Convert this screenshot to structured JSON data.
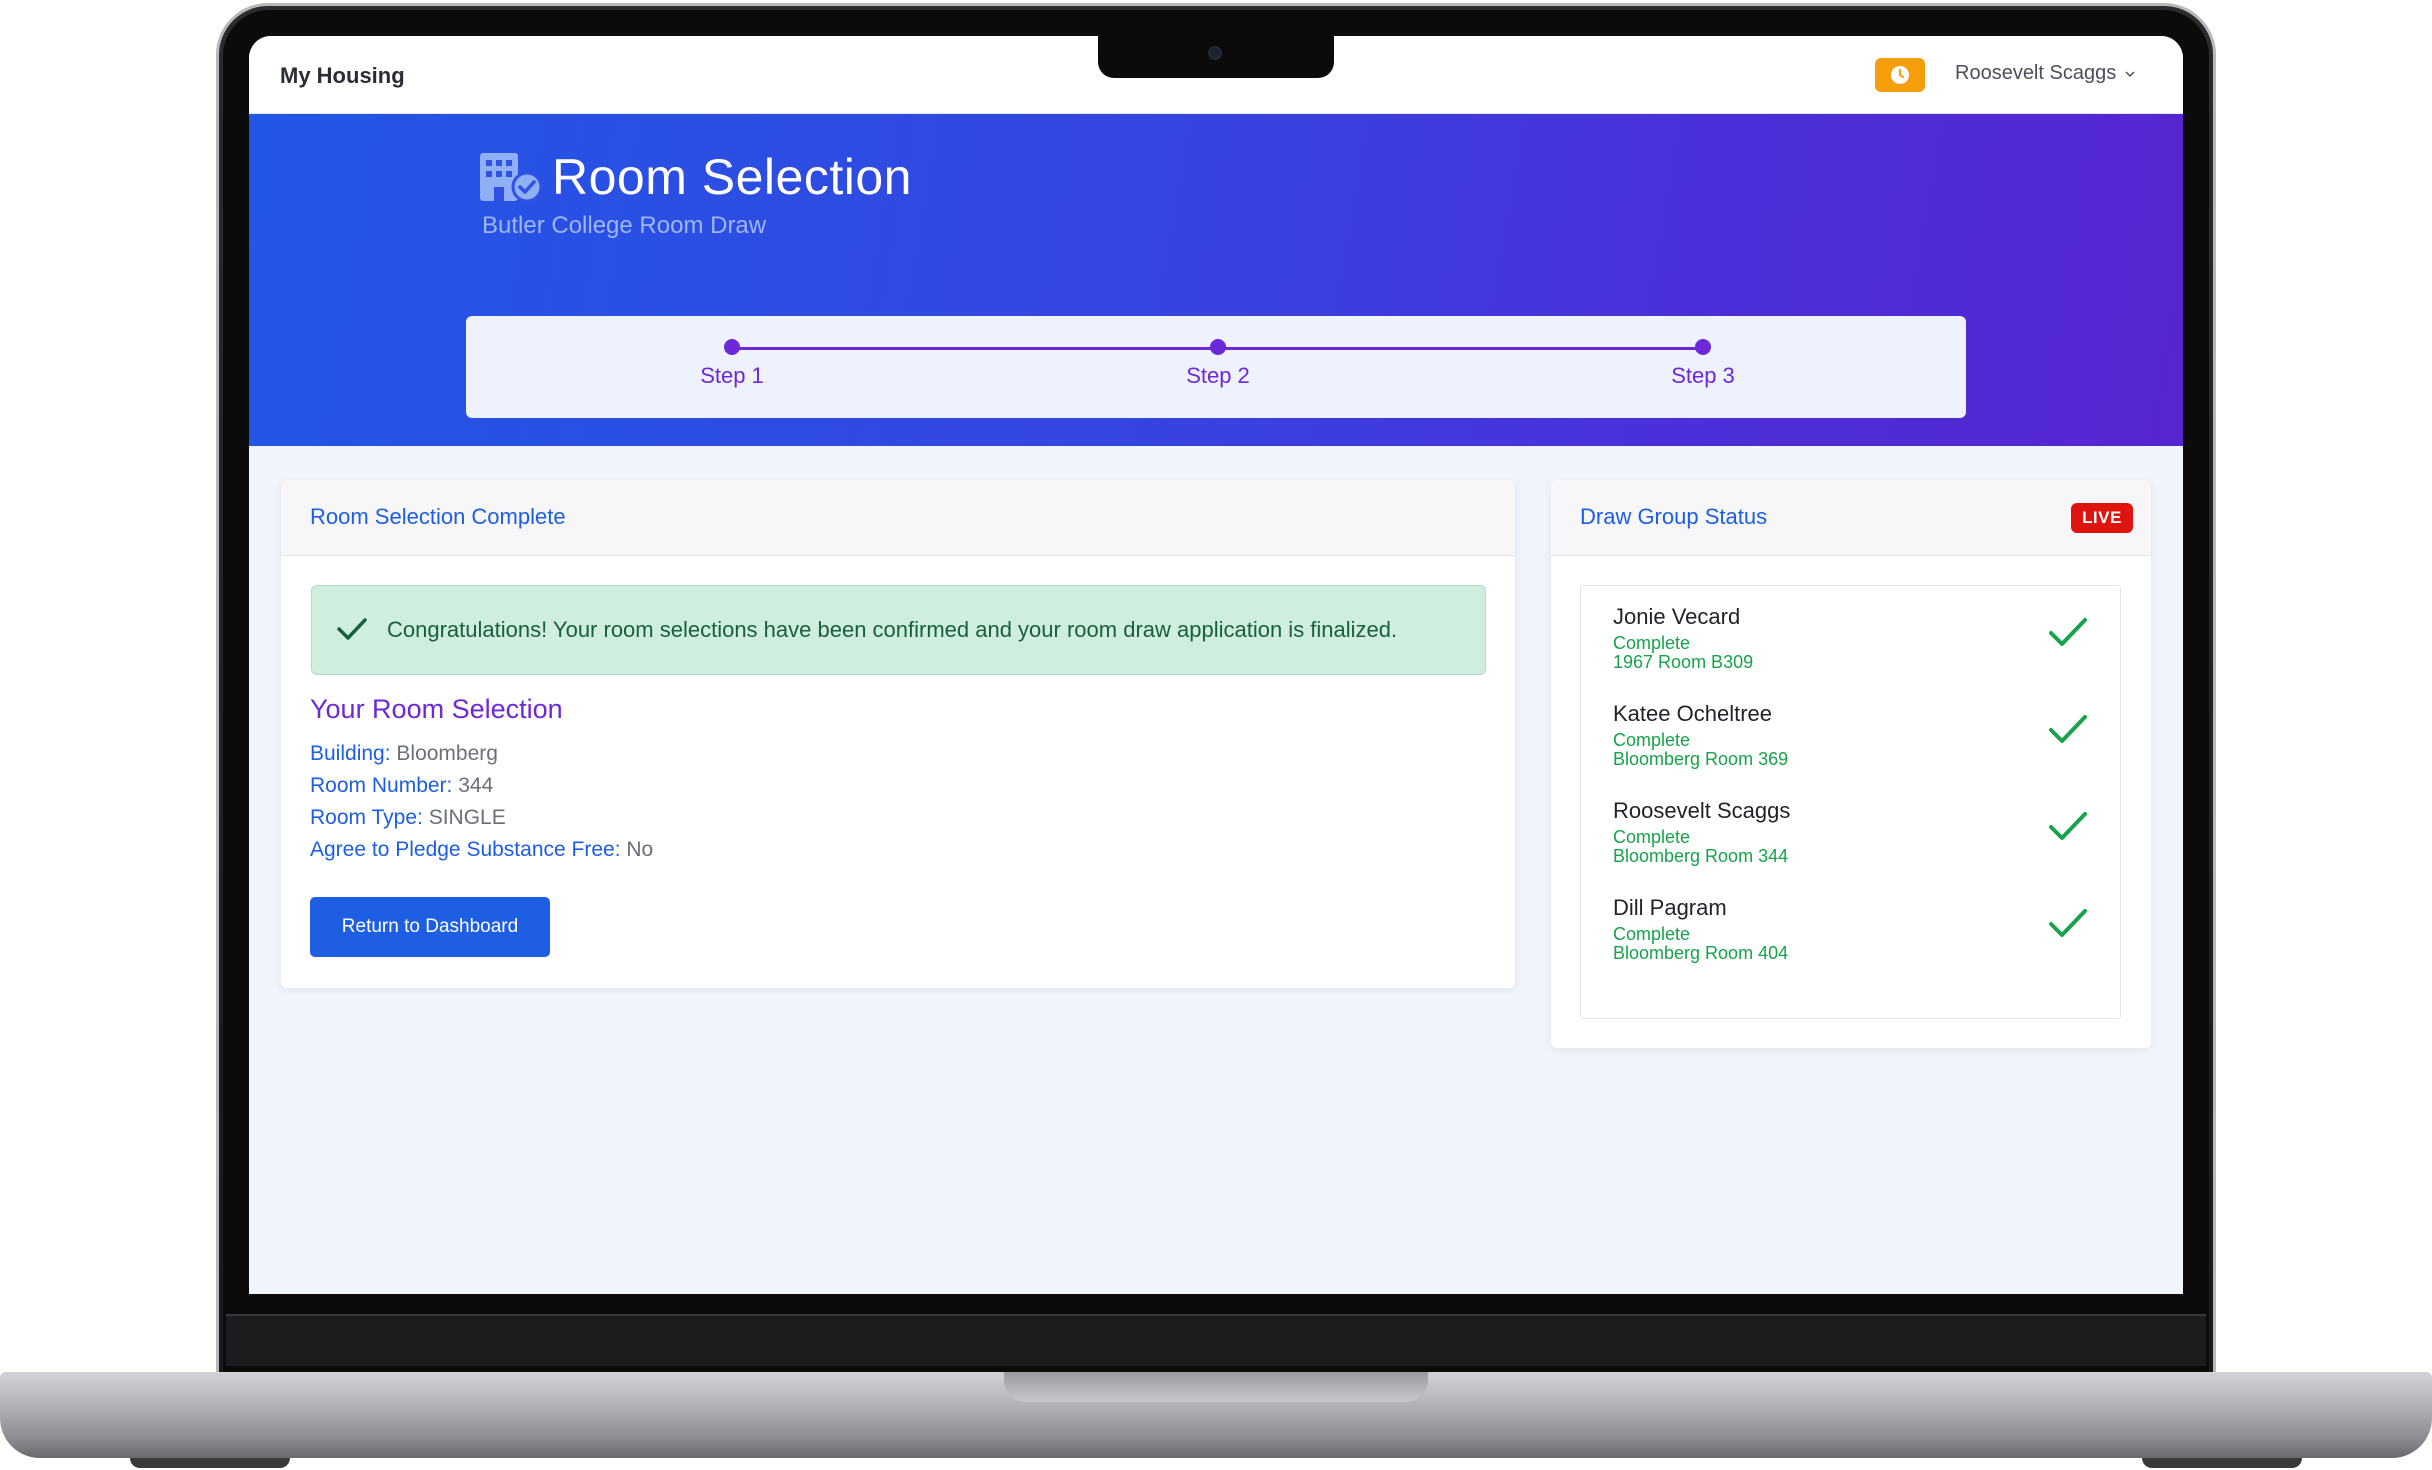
{
  "nav": {
    "brand": "My Housing",
    "user_name": "Roosevelt Scaggs",
    "timer_icon": "clock-icon"
  },
  "hero": {
    "title": "Room Selection",
    "subtitle": "Butler College Room Draw",
    "icon": "building-check-icon",
    "steps": [
      {
        "label": "Step 1"
      },
      {
        "label": "Step 2"
      },
      {
        "label": "Step 3"
      }
    ]
  },
  "selection_card": {
    "header": "Room Selection Complete",
    "alert": "Congratulations! Your room selections have been confirmed and your room draw application is finalized.",
    "section_title": "Your Room Selection",
    "fields": [
      {
        "key": "Building:",
        "value": "Bloomberg"
      },
      {
        "key": "Room Number:",
        "value": "344"
      },
      {
        "key": "Room Type:",
        "value": "SINGLE"
      },
      {
        "key": "Agree to Pledge Substance Free:",
        "value": "No"
      }
    ],
    "button": "Return to Dashboard"
  },
  "group_card": {
    "header": "Draw Group Status",
    "badge": "LIVE",
    "members": [
      {
        "name": "Jonie Vecard",
        "status": "Complete",
        "room": "1967 Room B309"
      },
      {
        "name": "Katee Ocheltree",
        "status": "Complete",
        "room": "Bloomberg Room 369"
      },
      {
        "name": "Roosevelt Scaggs",
        "status": "Complete",
        "room": "Bloomberg Room 344"
      },
      {
        "name": "Dill Pagram",
        "status": "Complete",
        "room": "Bloomberg Room 404"
      }
    ]
  },
  "colors": {
    "primary": "#1d5ee3",
    "accent_purple": "#6d28d9",
    "success": "#16a34a",
    "warning": "#f59e0b",
    "live_red": "#e0140f"
  }
}
